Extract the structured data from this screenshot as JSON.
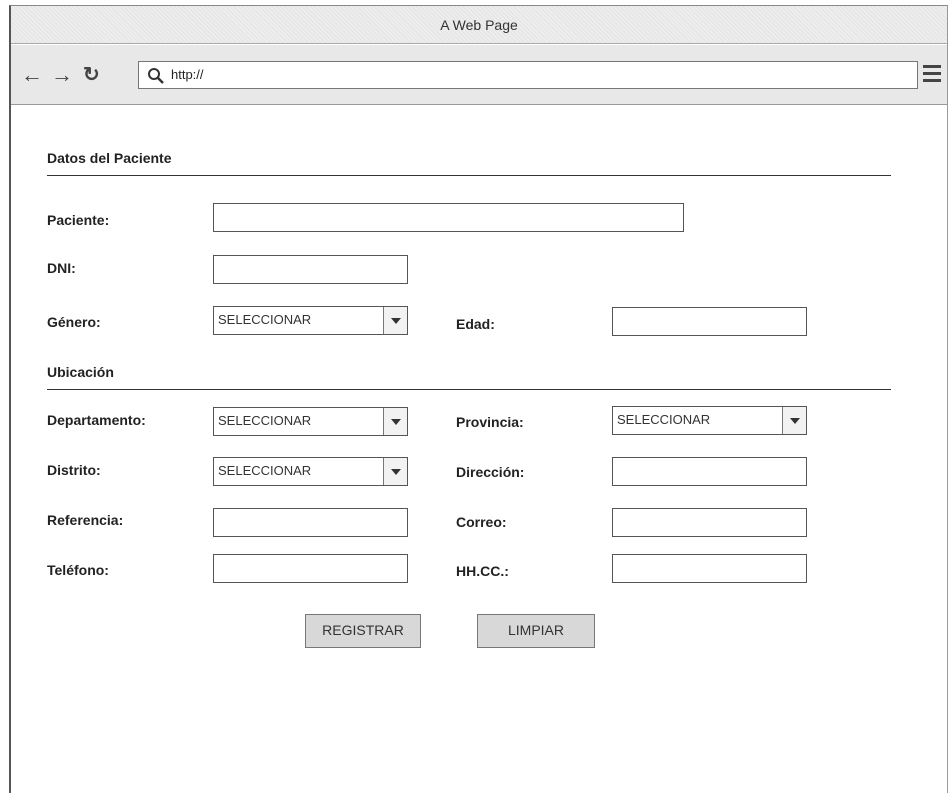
{
  "window": {
    "title": "A Web Page"
  },
  "browser": {
    "url": "http://"
  },
  "form": {
    "section_patient": "Datos del Paciente",
    "section_location": "Ubicación",
    "labels": {
      "paciente": "Paciente:",
      "dni": "DNI:",
      "genero": "Género:",
      "edad": "Edad:",
      "departamento": "Departamento:",
      "provincia": "Provincia:",
      "distrito": "Distrito:",
      "direccion": "Dirección:",
      "referencia": "Referencia:",
      "correo": "Correo:",
      "telefono": "Teléfono:",
      "hhcc": "HH.CC.:"
    },
    "values": {
      "paciente": "",
      "dni": "",
      "edad": "",
      "direccion": "",
      "referencia": "",
      "correo": "",
      "telefono": "",
      "hhcc": ""
    },
    "selects": {
      "genero": "SELECCIONAR",
      "departamento": "SELECCIONAR",
      "provincia": "SELECCIONAR",
      "distrito": "SELECCIONAR"
    },
    "buttons": {
      "registrar": "REGISTRAR",
      "limpiar": "LIMPIAR"
    }
  }
}
